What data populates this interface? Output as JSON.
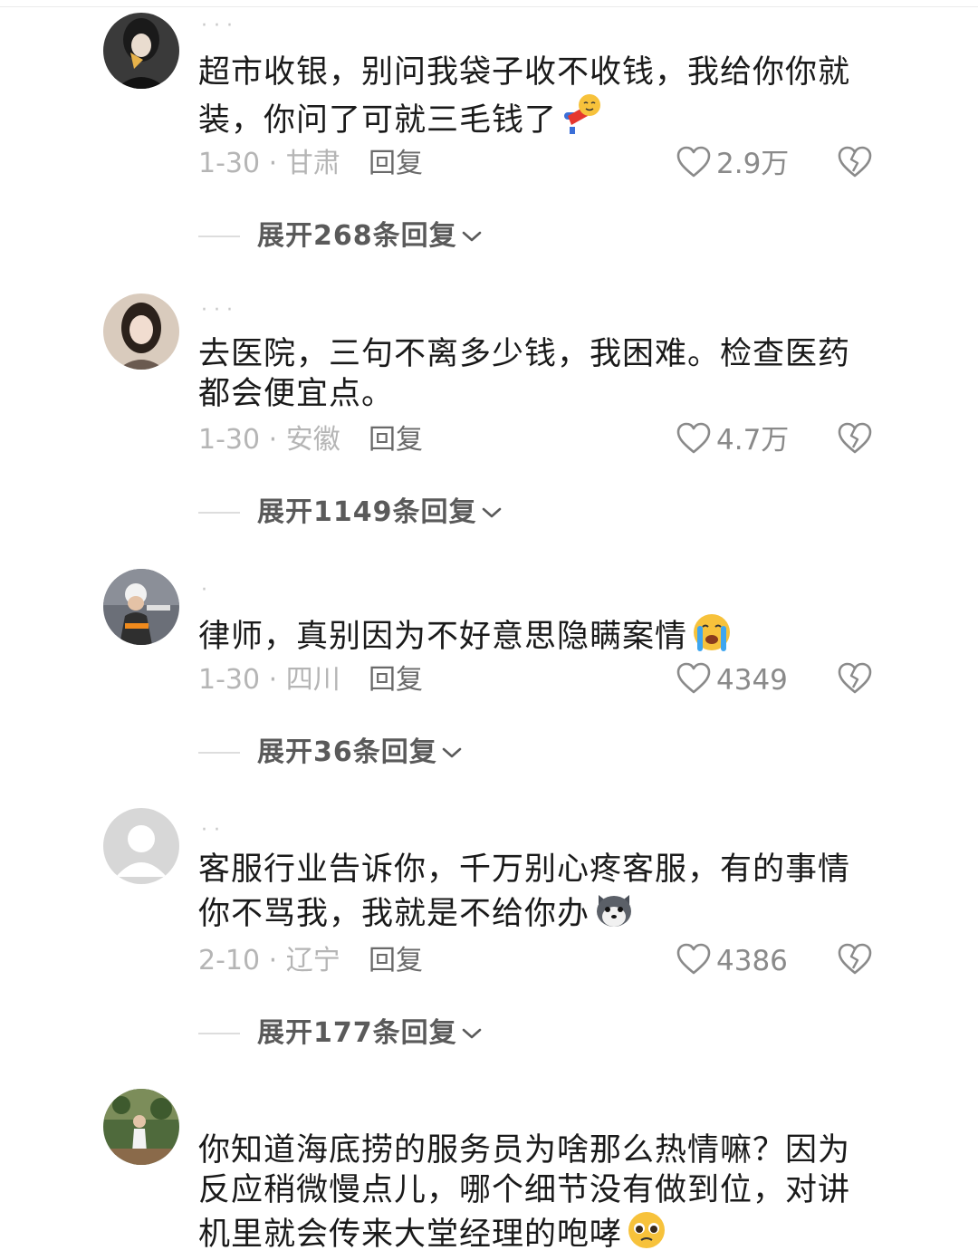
{
  "comments": [
    {
      "username": "· · ·",
      "text": "超市收银，别问我袋子收不收钱，我给你你就装，你问了可就三毛钱了",
      "emoji": "fainting-emoji",
      "date_location": "1-30 · 甘肃",
      "reply_label": "回复",
      "likes": "2.9万",
      "expand_label": "展开268条回复"
    },
    {
      "username": "· · ·",
      "text": "去医院，三句不离多少钱，我困难。检查医药都会便宜点。",
      "emoji": "",
      "date_location": "1-30 · 安徽",
      "reply_label": "回复",
      "likes": "4.7万",
      "expand_label": "展开1149条回复"
    },
    {
      "username": "·",
      "text": "律师，真别因为不好意思隐瞒案情",
      "emoji": "crying-emoji",
      "date_location": "1-30 · 四川",
      "reply_label": "回复",
      "likes": "4349",
      "expand_label": "展开36条回复"
    },
    {
      "username": "· ·",
      "text": "客服行业告诉你，千万别心疼客服，有的事情你不骂我，我就是不给你办",
      "emoji": "husky-emoji",
      "date_location": "2-10 · 辽宁",
      "reply_label": "回复",
      "likes": "4386",
      "expand_label": "展开177条回复"
    },
    {
      "username": "",
      "text": "你知道海底捞的服务员为啥那么热情嘛？因为反应稍微慢点儿，哪个细节没有做到位，对讲机里就会传来大堂经理的咆哮",
      "emoji": "pleading-emoji"
    }
  ]
}
